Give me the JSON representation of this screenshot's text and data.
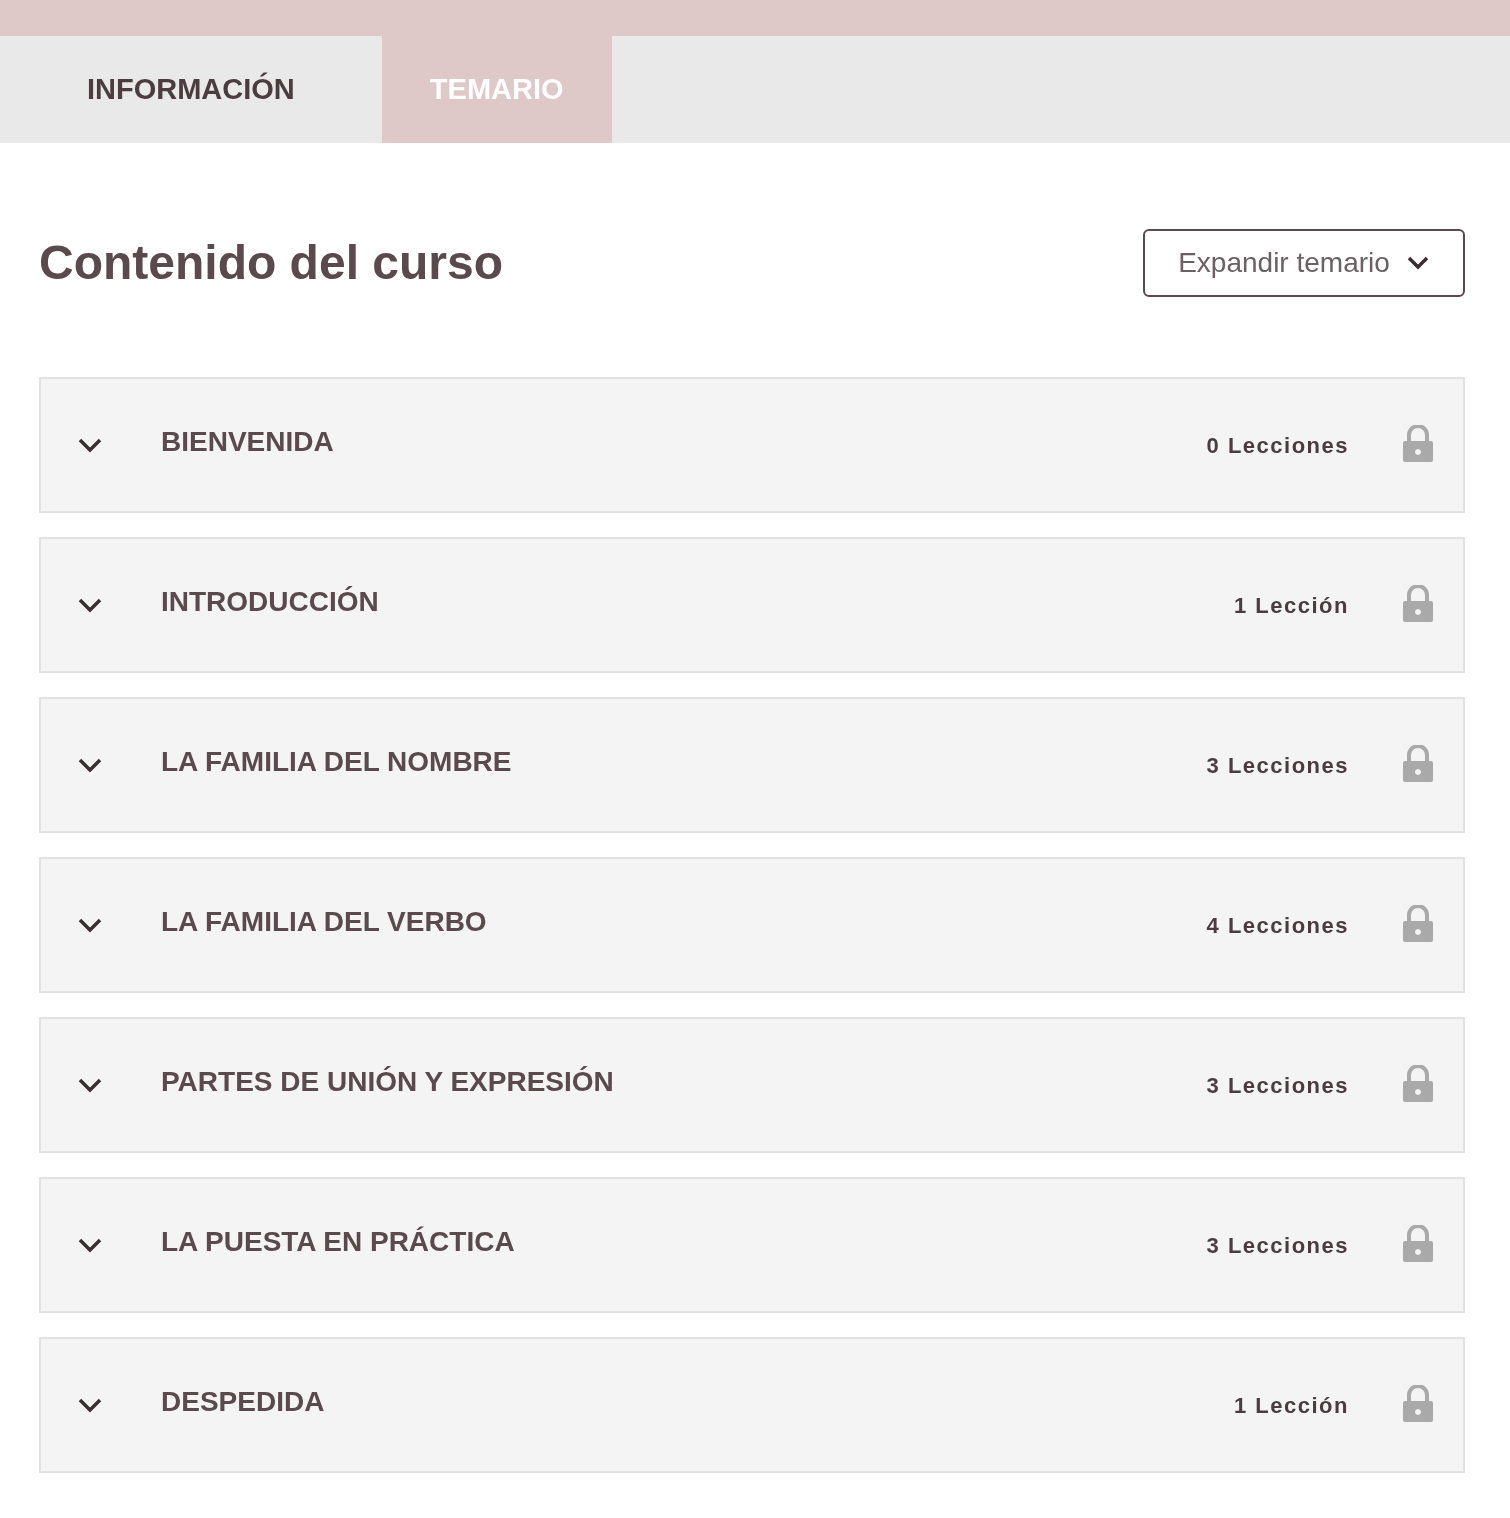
{
  "tabs": [
    {
      "label": "INFORMACIÓN",
      "selected": false
    },
    {
      "label": "TEMARIO",
      "selected": true
    }
  ],
  "heading": "Contenido del curso",
  "expand_button": "Expandir temario",
  "sections": [
    {
      "title": "BIENVENIDA",
      "count": "0 Lecciones",
      "expanded": false,
      "locked": true
    },
    {
      "title": "INTRODUCCIÓN",
      "count": "1 Lección",
      "expanded": false,
      "locked": true
    },
    {
      "title": "LA FAMILIA DEL NOMBRE",
      "count": "3 Lecciones",
      "expanded": false,
      "locked": true
    },
    {
      "title": "LA FAMILIA DEL VERBO",
      "count": "4 Lecciones",
      "expanded": false,
      "locked": true
    },
    {
      "title": "PARTES DE UNIÓN Y EXPRESIÓN",
      "count": "3 Lecciones",
      "expanded": false,
      "locked": true
    },
    {
      "title": "LA PUESTA EN PRÁCTICA",
      "count": "3 Lecciones",
      "expanded": false,
      "locked": true
    },
    {
      "title": "DESPEDIDA",
      "count": "1 Lección",
      "expanded": false,
      "locked": true
    }
  ]
}
